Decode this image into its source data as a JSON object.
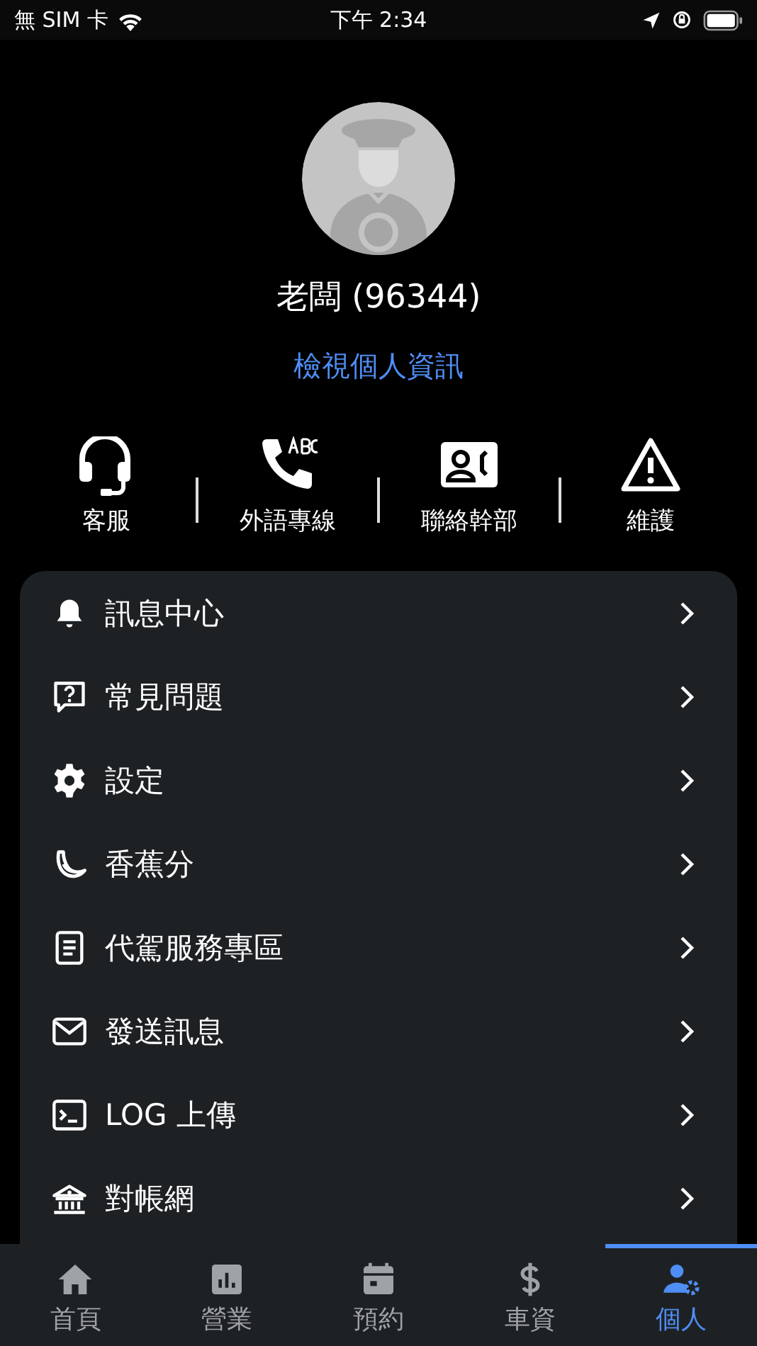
{
  "status_bar": {
    "carrier": "無 SIM 卡",
    "time": "下午 2:34"
  },
  "profile": {
    "name": "老闆 (96344)",
    "link": "檢視個人資訊"
  },
  "quick_actions": [
    {
      "label": "客服"
    },
    {
      "label": "外語專線"
    },
    {
      "label": "聯絡幹部"
    },
    {
      "label": "維護"
    }
  ],
  "menu": [
    {
      "label": "訊息中心"
    },
    {
      "label": "常見問題"
    },
    {
      "label": "設定"
    },
    {
      "label": "香蕉分"
    },
    {
      "label": "代駕服務專區"
    },
    {
      "label": "發送訊息"
    },
    {
      "label": "LOG 上傳"
    },
    {
      "label": "對帳網"
    }
  ],
  "tabs": [
    {
      "label": "首頁",
      "selected": false
    },
    {
      "label": "營業",
      "selected": false
    },
    {
      "label": "預約",
      "selected": false
    },
    {
      "label": "車資",
      "selected": false
    },
    {
      "label": "個人",
      "selected": true
    }
  ]
}
